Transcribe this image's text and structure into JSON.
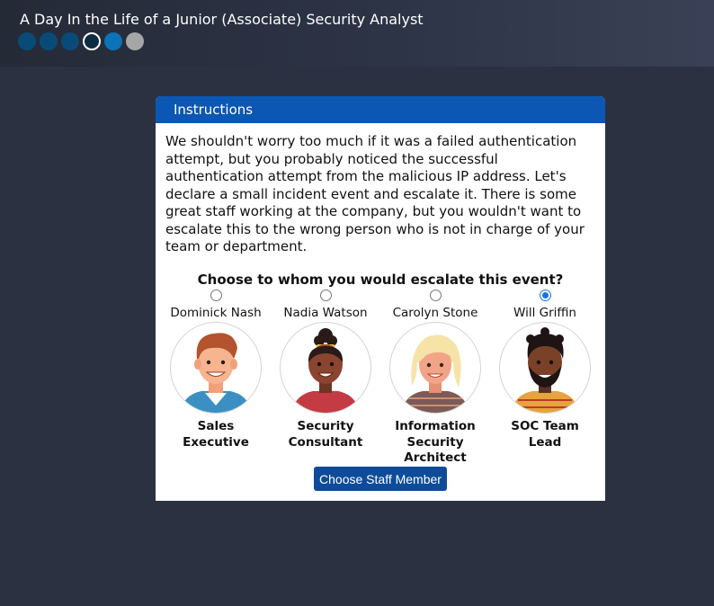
{
  "header": {
    "title": "A Day In the Life of a Junior (Associate) Security Analyst",
    "progress_steps": [
      "done",
      "done",
      "done",
      "current",
      "next",
      "locked"
    ]
  },
  "card": {
    "title": "Instructions",
    "body": "We shouldn't worry too much if it was a failed authentication attempt, but you probably noticed the successful authentication attempt from the malicious IP address. Let's declare a small incident event and escalate it. There is some great staff working at the company, but you wouldn't want to escalate this to the wrong person who is not in charge of your team or department.",
    "question": "Choose to whom you would escalate this event?",
    "options": [
      {
        "name": "Dominick Nash",
        "role": "Sales Executive",
        "selected": false
      },
      {
        "name": "Nadia Watson",
        "role": "Security Consultant",
        "selected": false
      },
      {
        "name": "Carolyn Stone",
        "role": "Information Security Architect",
        "selected": false
      },
      {
        "name": "Will Griffin",
        "role": "SOC Team Lead",
        "selected": true
      }
    ],
    "submit_label": "Choose Staff Member"
  },
  "colors": {
    "background": "#2c3142",
    "header_accent": "#0b57b3",
    "button": "#0e4c99",
    "radio_selected": "#1a73e8"
  }
}
